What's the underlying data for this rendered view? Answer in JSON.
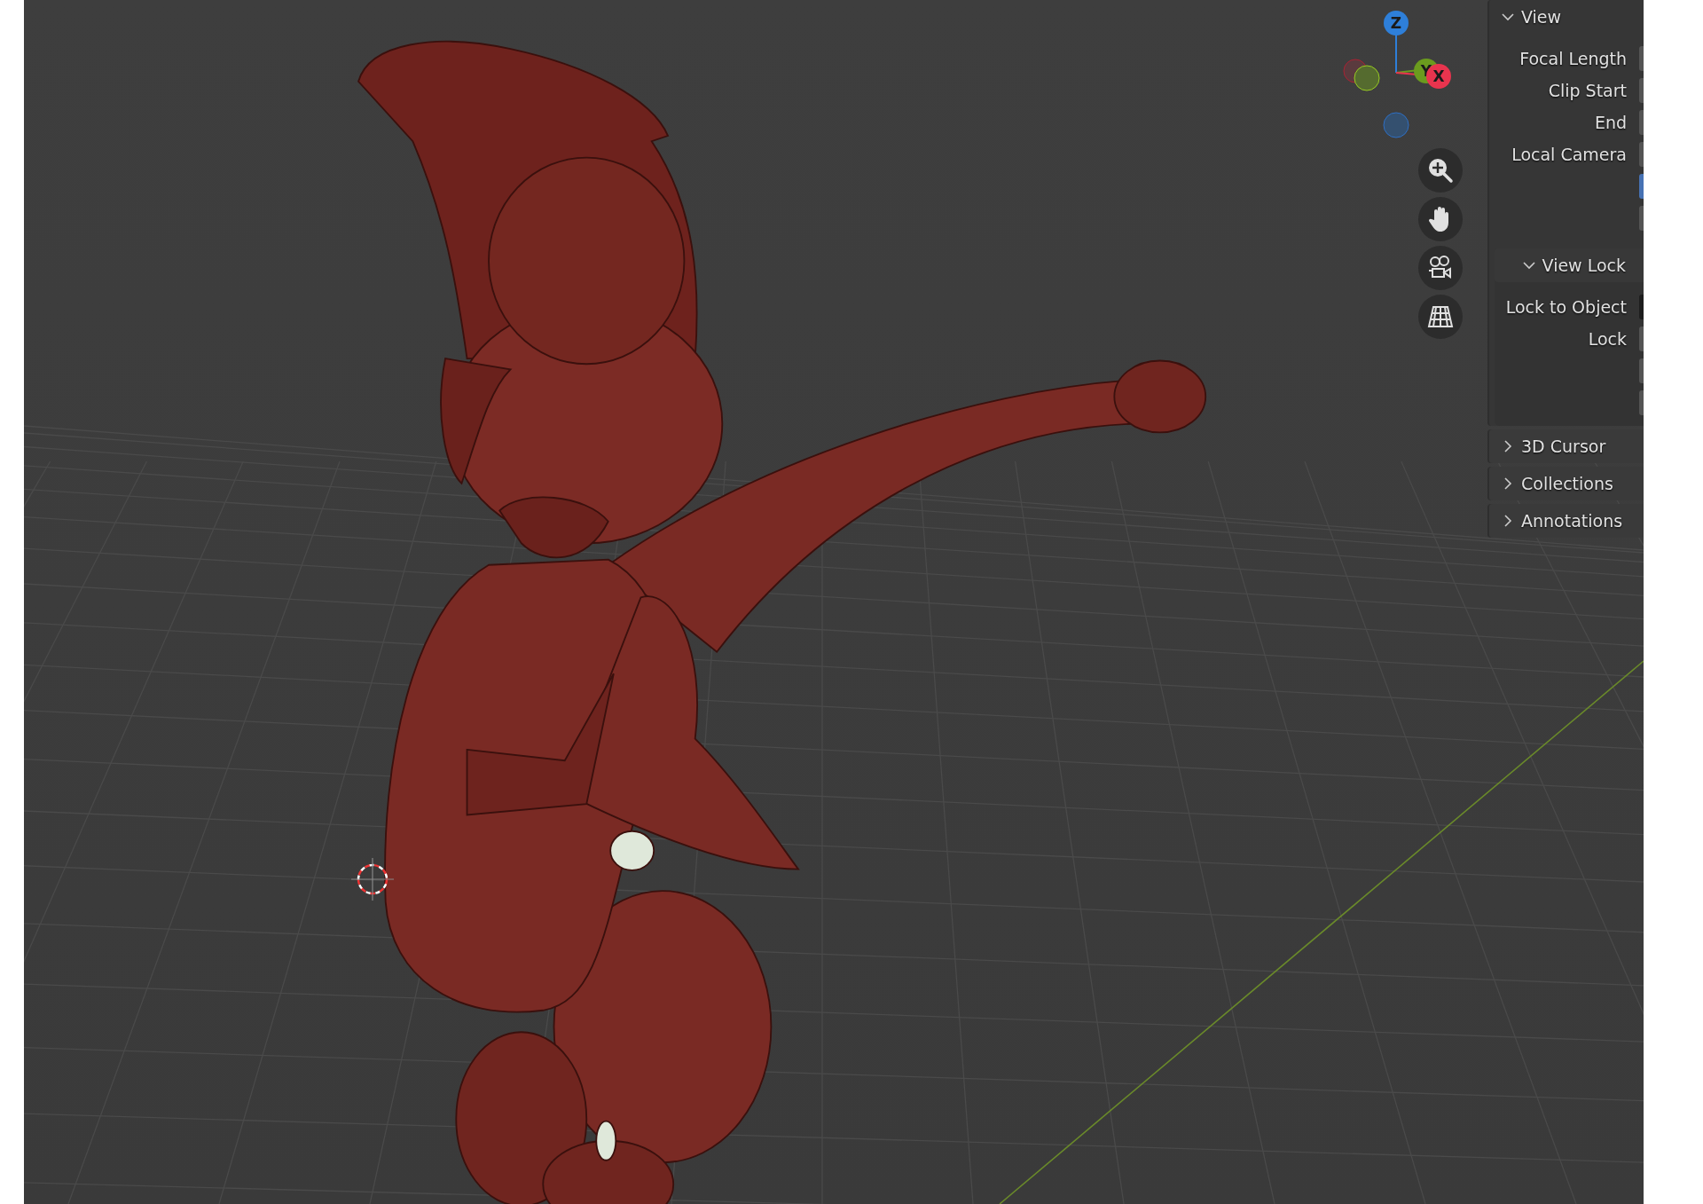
{
  "gizmo": {
    "axes": [
      {
        "kind": "z",
        "label": "Z",
        "color": "#2e7fd9"
      },
      {
        "kind": "y",
        "label": "Y",
        "color": "#6b9b1e"
      },
      {
        "kind": "x",
        "label": "X",
        "color": "#e8344e"
      }
    ]
  },
  "sidebar": {
    "sections": [
      {
        "title": "View",
        "expanded": true,
        "rows": [
          {
            "label": "Focal Length",
            "kind": "field"
          },
          {
            "label": "Clip Start",
            "kind": "field"
          },
          {
            "label": "End",
            "kind": "field"
          },
          {
            "label": "Local Camera",
            "kind": "field"
          },
          {
            "kind": "toggle",
            "on": true
          },
          {
            "kind": "field"
          }
        ],
        "subsections": [
          {
            "title": "View Lock",
            "expanded": true,
            "rows": [
              {
                "label": "Lock to Object",
                "kind": "object-field"
              },
              {
                "label": "Lock",
                "kind": "field"
              },
              {
                "kind": "field"
              },
              {
                "kind": "field"
              }
            ]
          }
        ]
      },
      {
        "title": "3D Cursor",
        "expanded": false
      },
      {
        "title": "Collections",
        "expanded": false
      },
      {
        "title": "Annotations",
        "expanded": false
      }
    ]
  }
}
